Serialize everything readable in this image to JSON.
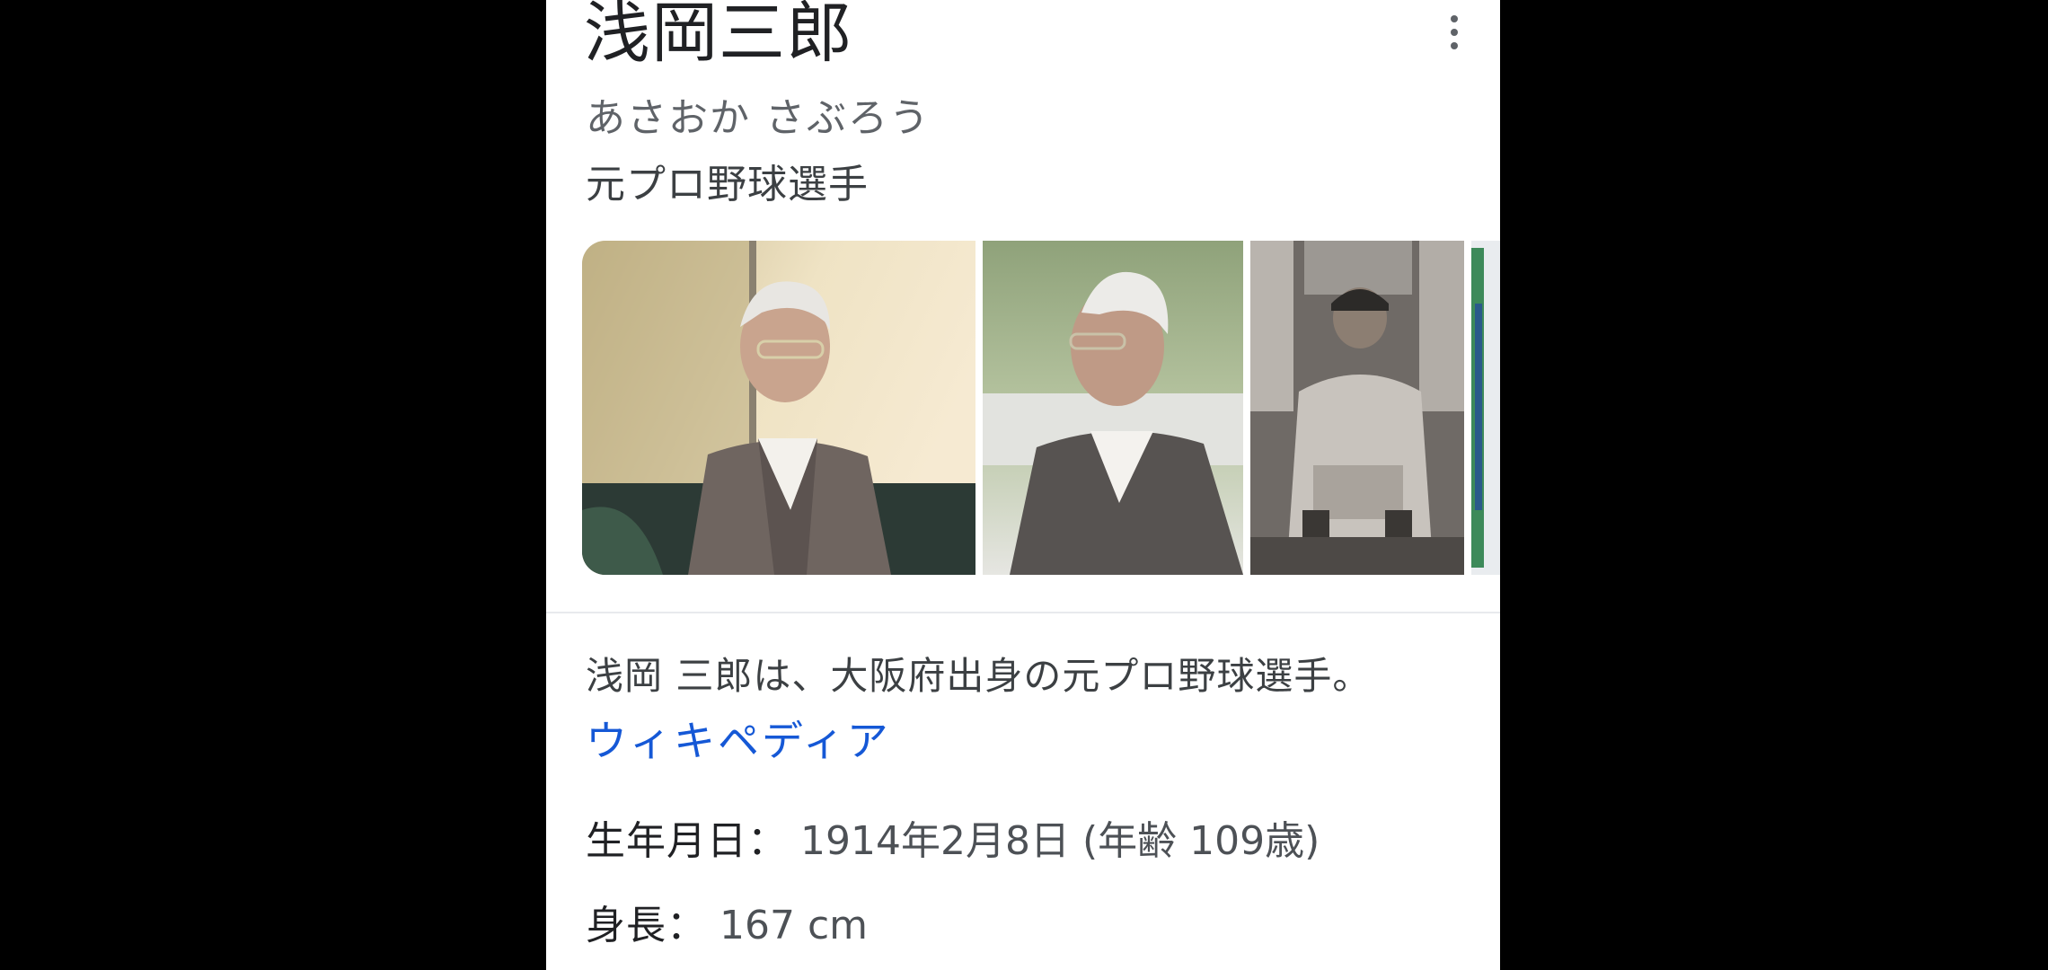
{
  "entity": {
    "name": "浅岡三郎",
    "reading": "あさおか さぶろう",
    "occupation": "元プロ野球選手"
  },
  "description": {
    "text": "浅岡 三郎は、大阪府出身の元プロ野球選手。",
    "source_label": "ウィキペディア"
  },
  "facts": [
    {
      "key": "生年月日：",
      "value": "1914年2月8日 (年齢 109歳)"
    },
    {
      "key": "身長：",
      "value": "167 cm"
    }
  ],
  "icons": {
    "menu": "more-vert-icon"
  },
  "colors": {
    "link": "#1558d6",
    "text_primary": "#202124",
    "text_secondary": "#5f6368",
    "background": "#ffffff",
    "outer": "#000000"
  }
}
